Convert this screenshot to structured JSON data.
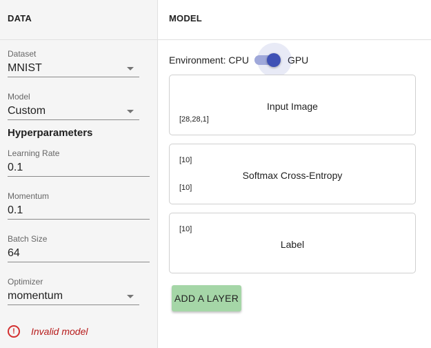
{
  "data_panel": {
    "header": "DATA",
    "dataset": {
      "label": "Dataset",
      "value": "MNIST"
    },
    "model": {
      "label": "Model",
      "value": "Custom"
    },
    "hyperparameters_title": "Hyperparameters",
    "learning_rate": {
      "label": "Learning Rate",
      "value": "0.1"
    },
    "momentum": {
      "label": "Momentum",
      "value": "0.1"
    },
    "batch_size": {
      "label": "Batch Size",
      "value": "64"
    },
    "optimizer": {
      "label": "Optimizer",
      "value": "momentum"
    },
    "error": {
      "icon": "error-outline-icon",
      "text": "Invalid model"
    }
  },
  "model_panel": {
    "header": "MODEL",
    "environment": {
      "prefix": "Environment: CPU",
      "suffix": "GPU",
      "gpu_enabled": true
    },
    "layers": [
      {
        "title": "Input Image",
        "output_shape": "[28,28,1]"
      },
      {
        "title": "Softmax Cross-Entropy",
        "input_shape": "[10]",
        "output_shape": "[10]"
      },
      {
        "title": "Label",
        "input_shape": "[10]"
      }
    ],
    "add_layer_label": "ADD A LAYER"
  },
  "colors": {
    "accent": "#3f51b5",
    "switch_track": "#9fa8da",
    "add_button": "#a5d6a7",
    "error": "#d32f2f",
    "sidebar_bg": "#f5f5f5"
  }
}
